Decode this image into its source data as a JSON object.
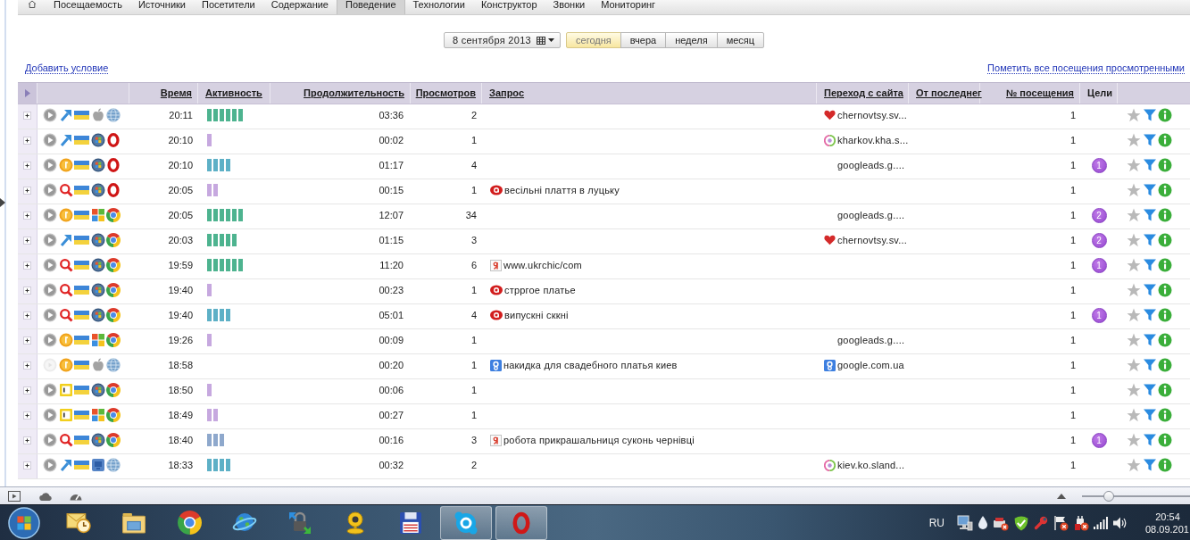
{
  "nav": {
    "tabs": [
      {
        "label": "Посещаемость",
        "selected": false
      },
      {
        "label": "Источники",
        "selected": false
      },
      {
        "label": "Посетители",
        "selected": false
      },
      {
        "label": "Содержание",
        "selected": false
      },
      {
        "label": "Поведение",
        "selected": true
      },
      {
        "label": "Технологии",
        "selected": false
      },
      {
        "label": "Конструктор",
        "selected": false
      },
      {
        "label": "Звонки",
        "selected": false
      },
      {
        "label": "Мониторинг",
        "selected": false
      }
    ]
  },
  "date_picker": {
    "value": "8 сентября 2013"
  },
  "periods": [
    {
      "label": "сегодня",
      "selected": true
    },
    {
      "label": "вчера",
      "selected": false
    },
    {
      "label": "неделя",
      "selected": false
    },
    {
      "label": "месяц",
      "selected": false
    }
  ],
  "links": {
    "add_condition": "Добавить условие",
    "mark_all_viewed": "Пометить все посещения просмотренными"
  },
  "table": {
    "columns": [
      {
        "label": "Время",
        "sortable": true
      },
      {
        "label": "Активность",
        "sortable": true
      },
      {
        "label": "Продолжительность",
        "sortable": true
      },
      {
        "label": "Просмотров",
        "sortable": true
      },
      {
        "label": "Запрос",
        "sortable": true
      },
      {
        "label": "Переход с сайта",
        "sortable": true
      },
      {
        "label": "От последнег",
        "sortable": true
      },
      {
        "label": "№ посещения",
        "sortable": true
      },
      {
        "label": "Цели",
        "sortable": false
      }
    ],
    "rows": [
      {
        "expanded": false,
        "play_disabled": false,
        "source": {
          "kind": "arrow"
        },
        "os": {
          "kind": "apple"
        },
        "browser": {
          "kind": "globe"
        },
        "time": "20:11",
        "activity": [
          {
            "color": "#4db38f"
          },
          {
            "color": "#4db38f"
          },
          {
            "color": "#4db38f"
          },
          {
            "color": "#4db38f"
          },
          {
            "color": "#4db38f"
          },
          {
            "color": "#4db38f"
          }
        ],
        "duration": "03:36",
        "views": "2",
        "referrer": {
          "kind": "heart",
          "text": "chernovtsy.sv..."
        },
        "visit": "1",
        "starred": false
      },
      {
        "expanded": false,
        "play_disabled": false,
        "source": {
          "kind": "arrow"
        },
        "os": {
          "kind": "orb"
        },
        "browser": {
          "kind": "ring"
        },
        "time": "20:10",
        "activity": [
          {
            "color": "#c6a8df"
          }
        ],
        "duration": "00:02",
        "views": "1",
        "referrer": {
          "kind": "swirl",
          "text": "kharkov.kha.s..."
        },
        "visit": "1",
        "starred": false
      },
      {
        "expanded": false,
        "play_disabled": false,
        "source": {
          "kind": "coin"
        },
        "os": {
          "kind": "orb"
        },
        "browser": {
          "kind": "ring"
        },
        "time": "20:10",
        "activity": [
          {
            "color": "#5db0c6"
          },
          {
            "color": "#5db0c6"
          },
          {
            "color": "#5db0c6"
          },
          {
            "color": "#5db0c6"
          }
        ],
        "duration": "01:17",
        "views": "4",
        "referrer": {
          "text": "googleads.g...."
        },
        "visit": "1",
        "goals": "1",
        "starred": false
      },
      {
        "expanded": false,
        "play_disabled": false,
        "source": {
          "kind": "magnifier"
        },
        "os": {
          "kind": "orb"
        },
        "browser": {
          "kind": "ring"
        },
        "time": "20:05",
        "activity": [
          {
            "color": "#c6a8df"
          },
          {
            "color": "#c6a8df"
          }
        ],
        "duration": "00:15",
        "views": "1",
        "query": {
          "kind": "oval",
          "text": "весільні плаття в луцьку"
        },
        "visit": "1",
        "starred": false
      },
      {
        "expanded": false,
        "play_disabled": false,
        "source": {
          "kind": "coin"
        },
        "os": {
          "kind": "panes"
        },
        "browser": {
          "kind": "wheel"
        },
        "time": "20:05",
        "activity": [
          {
            "color": "#4db38f"
          },
          {
            "color": "#4db38f"
          },
          {
            "color": "#4db38f"
          },
          {
            "color": "#4db38f"
          },
          {
            "color": "#4db38f"
          },
          {
            "color": "#4db38f"
          }
        ],
        "duration": "12:07",
        "views": "34",
        "referrer": {
          "text": "googleads.g...."
        },
        "visit": "1",
        "goals": "2",
        "starred": false
      },
      {
        "expanded": false,
        "play_disabled": false,
        "source": {
          "kind": "arrow"
        },
        "os": {
          "kind": "orb"
        },
        "browser": {
          "kind": "wheel"
        },
        "time": "20:03",
        "activity": [
          {
            "color": "#4db38f"
          },
          {
            "color": "#4db38f"
          },
          {
            "color": "#4db38f"
          },
          {
            "color": "#4db38f"
          },
          {
            "color": "#4db38f"
          }
        ],
        "duration": "01:15",
        "views": "3",
        "referrer": {
          "kind": "heart",
          "text": "chernovtsy.sv..."
        },
        "visit": "1",
        "goals": "2",
        "starred": false
      },
      {
        "expanded": false,
        "play_disabled": false,
        "source": {
          "kind": "magnifier"
        },
        "os": {
          "kind": "orb"
        },
        "browser": {
          "kind": "wheel"
        },
        "time": "19:59",
        "activity": [
          {
            "color": "#4db38f"
          },
          {
            "color": "#4db38f"
          },
          {
            "color": "#4db38f"
          },
          {
            "color": "#4db38f"
          },
          {
            "color": "#4db38f"
          },
          {
            "color": "#4db38f"
          }
        ],
        "duration": "11:20",
        "views": "6",
        "query": {
          "kind": "ya",
          "text": "www.ukrchic/com"
        },
        "visit": "1",
        "goals": "1",
        "starred": false
      },
      {
        "expanded": false,
        "play_disabled": false,
        "source": {
          "kind": "magnifier"
        },
        "os": {
          "kind": "orb"
        },
        "browser": {
          "kind": "wheel"
        },
        "time": "19:40",
        "activity": [
          {
            "color": "#c6a8df"
          }
        ],
        "duration": "00:23",
        "views": "1",
        "query": {
          "kind": "oval",
          "text": "стрргое платье"
        },
        "visit": "1",
        "starred": false
      },
      {
        "expanded": false,
        "play_disabled": false,
        "source": {
          "kind": "magnifier"
        },
        "os": {
          "kind": "orb"
        },
        "browser": {
          "kind": "wheel"
        },
        "time": "19:40",
        "activity": [
          {
            "color": "#5db0c6"
          },
          {
            "color": "#5db0c6"
          },
          {
            "color": "#5db0c6"
          },
          {
            "color": "#5db0c6"
          }
        ],
        "duration": "05:01",
        "views": "4",
        "query": {
          "kind": "oval",
          "text": "випускні сккні"
        },
        "visit": "1",
        "goals": "1",
        "starred": false
      },
      {
        "expanded": false,
        "play_disabled": false,
        "source": {
          "kind": "coin"
        },
        "os": {
          "kind": "panes"
        },
        "browser": {
          "kind": "wheel"
        },
        "time": "19:26",
        "activity": [
          {
            "color": "#c6a8df"
          }
        ],
        "duration": "00:09",
        "views": "1",
        "referrer": {
          "text": "googleads.g...."
        },
        "visit": "1",
        "starred": false
      },
      {
        "expanded": false,
        "play_disabled": true,
        "source": {
          "kind": "coin"
        },
        "os": {
          "kind": "apple"
        },
        "browser": {
          "kind": "globe"
        },
        "time": "18:58",
        "duration": "00:20",
        "views": "1",
        "query": {
          "kind": "g",
          "text": "накидка для свадебного платья киев"
        },
        "referrer": {
          "kind": "g",
          "text": "google.com.ua"
        },
        "visit": "1",
        "starred": false
      },
      {
        "expanded": false,
        "play_disabled": false,
        "source": {
          "kind": "window"
        },
        "os": {
          "kind": "orb"
        },
        "browser": {
          "kind": "wheel"
        },
        "time": "18:50",
        "activity": [
          {
            "color": "#c6a8df"
          }
        ],
        "duration": "00:06",
        "views": "1",
        "visit": "1",
        "starred": false
      },
      {
        "expanded": false,
        "play_disabled": false,
        "source": {
          "kind": "window"
        },
        "os": {
          "kind": "panes"
        },
        "browser": {
          "kind": "wheel"
        },
        "time": "18:49",
        "activity": [
          {
            "color": "#c6a8df"
          },
          {
            "color": "#c6a8df"
          }
        ],
        "duration": "00:27",
        "views": "1",
        "visit": "1",
        "starred": false
      },
      {
        "expanded": false,
        "play_disabled": false,
        "source": {
          "kind": "magnifier"
        },
        "os": {
          "kind": "orb"
        },
        "browser": {
          "kind": "wheel"
        },
        "time": "18:40",
        "activity": [
          {
            "color": "#8ea8cc"
          },
          {
            "color": "#8ea8cc"
          },
          {
            "color": "#8ea8cc"
          }
        ],
        "duration": "00:16",
        "views": "3",
        "query": {
          "kind": "ya",
          "text": "робота прикрашальниця суконь чернівці"
        },
        "visit": "1",
        "goals": "1",
        "starred": false
      },
      {
        "expanded": false,
        "play_disabled": false,
        "source": {
          "kind": "arrow"
        },
        "os": {
          "kind": "tile"
        },
        "browser": {
          "kind": "globe"
        },
        "time": "18:33",
        "activity": [
          {
            "color": "#5db0c6"
          },
          {
            "color": "#5db0c6"
          },
          {
            "color": "#5db0c6"
          },
          {
            "color": "#5db0c6"
          }
        ],
        "duration": "00:32",
        "views": "2",
        "referrer": {
          "kind": "swirl",
          "text": "kiev.ko.sland..."
        },
        "visit": "1",
        "starred": false
      }
    ]
  },
  "status_bar": {
    "zoom": {
      "level": 0.25
    }
  },
  "taskbar": {
    "apps": [
      {
        "kind": "mail",
        "active": false
      },
      {
        "kind": "folder",
        "active": false
      },
      {
        "kind": "wheel",
        "active": false
      },
      {
        "kind": "globe",
        "active": false
      },
      {
        "kind": "lock",
        "active": false
      },
      {
        "kind": "webcam",
        "active": false
      },
      {
        "kind": "floppy",
        "active": false
      },
      {
        "kind": "bubble",
        "active": true
      },
      {
        "kind": "ring",
        "active": true
      }
    ],
    "language": "RU",
    "time": "20:54",
    "date": "08.09.201"
  }
}
